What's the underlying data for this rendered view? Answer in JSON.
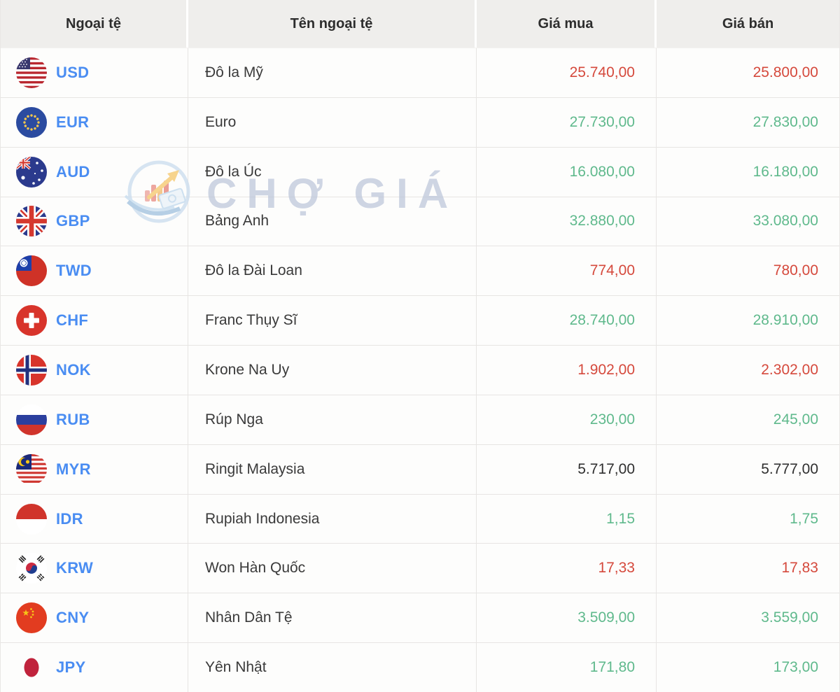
{
  "table": {
    "columns": [
      {
        "label": "Ngoại tệ"
      },
      {
        "label": "Tên ngoại tệ"
      },
      {
        "label": "Giá mua"
      },
      {
        "label": "Giá bán"
      }
    ],
    "rows": [
      {
        "code": "USD",
        "name": "Đô la Mỹ",
        "buy": "25.740,00",
        "sell": "25.800,00",
        "trend": "down",
        "flag": "usd-flag-icon"
      },
      {
        "code": "EUR",
        "name": "Euro",
        "buy": "27.730,00",
        "sell": "27.830,00",
        "trend": "up",
        "flag": "eur-flag-icon"
      },
      {
        "code": "AUD",
        "name": "Đô la Úc",
        "buy": "16.080,00",
        "sell": "16.180,00",
        "trend": "up",
        "flag": "aud-flag-icon"
      },
      {
        "code": "GBP",
        "name": "Bảng Anh",
        "buy": "32.880,00",
        "sell": "33.080,00",
        "trend": "up",
        "flag": "gbp-flag-icon"
      },
      {
        "code": "TWD",
        "name": "Đô la Đài Loan",
        "buy": "774,00",
        "sell": "780,00",
        "trend": "down",
        "flag": "twd-flag-icon"
      },
      {
        "code": "CHF",
        "name": "Franc Thụy Sĩ",
        "buy": "28.740,00",
        "sell": "28.910,00",
        "trend": "up",
        "flag": "chf-flag-icon"
      },
      {
        "code": "NOK",
        "name": "Krone Na Uy",
        "buy": "1.902,00",
        "sell": "2.302,00",
        "trend": "down",
        "flag": "nok-flag-icon"
      },
      {
        "code": "RUB",
        "name": "Rúp Nga",
        "buy": "230,00",
        "sell": "245,00",
        "trend": "up",
        "flag": "rub-flag-icon"
      },
      {
        "code": "MYR",
        "name": "Ringit Malaysia",
        "buy": "5.717,00",
        "sell": "5.777,00",
        "trend": "unchanged",
        "flag": "myr-flag-icon"
      },
      {
        "code": "IDR",
        "name": "Rupiah Indonesia",
        "buy": "1,15",
        "sell": "1,75",
        "trend": "up",
        "flag": "idr-flag-icon"
      },
      {
        "code": "KRW",
        "name": "Won Hàn Quốc",
        "buy": "17,33",
        "sell": "17,83",
        "trend": "down",
        "flag": "krw-flag-icon"
      },
      {
        "code": "CNY",
        "name": "Nhân Dân Tệ",
        "buy": "3.509,00",
        "sell": "3.559,00",
        "trend": "up",
        "flag": "cny-flag-icon"
      },
      {
        "code": "JPY",
        "name": "Yên Nhật",
        "buy": "171,80",
        "sell": "173,00",
        "trend": "up",
        "flag": "jpy-flag-icon"
      }
    ]
  },
  "watermark": {
    "text": "CHỢ GIÁ"
  },
  "colors": {
    "up": "#5fb98c",
    "down": "#d5493c",
    "unchanged": "#2f2f2f",
    "code_blue": "#4a8df2",
    "header_bg": "#efeeec",
    "border": "#e7e5e3"
  }
}
